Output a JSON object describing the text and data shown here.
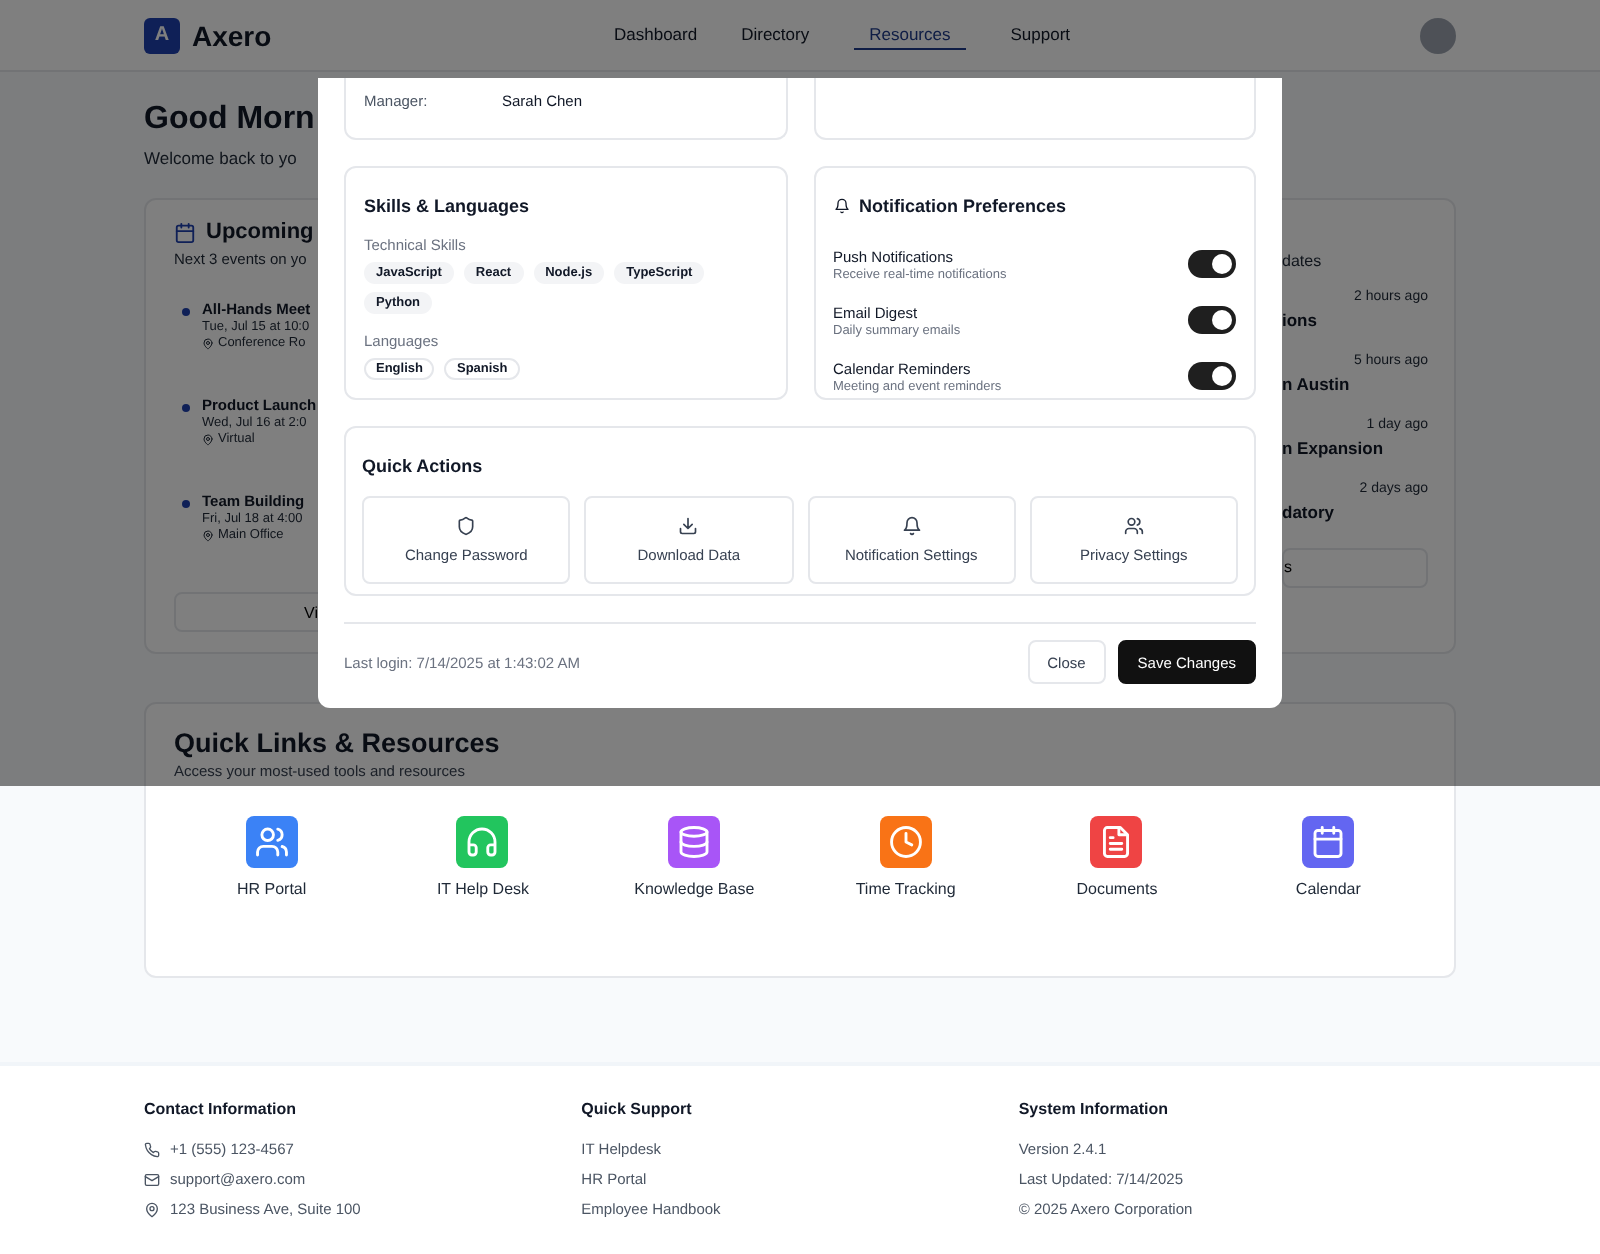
{
  "header": {
    "logo_letter": "A",
    "brand": "Axero",
    "nav": [
      {
        "label": "Dashboard",
        "selected": false
      },
      {
        "label": "Directory",
        "selected": false
      },
      {
        "label": "Resources",
        "selected": true
      },
      {
        "label": "Support",
        "selected": false
      }
    ]
  },
  "greeting": {
    "title": "Good Morn",
    "subtitle": "Welcome back to yo"
  },
  "events_card": {
    "title": "Upcoming",
    "subtitle": "Next 3 events on yo",
    "events": [
      {
        "title": "All-Hands Meet",
        "time": "Tue, Jul 15 at 10:0",
        "location": "Conference Ro"
      },
      {
        "title": "Product Launch",
        "time": "Wed, Jul 16 at 2:0",
        "location": "Virtual"
      },
      {
        "title": "Team Building",
        "time": "Fri, Jul 18 at 4:00",
        "location": "Main Office"
      }
    ],
    "button": "Vi"
  },
  "updates_card": {
    "subtitle": "dates",
    "items": [
      {
        "time": "2 hours ago",
        "title": "ions"
      },
      {
        "time": "5 hours ago",
        "title": "n Austin"
      },
      {
        "time": "1 day ago",
        "title": "n Expansion"
      },
      {
        "time": "2 days ago",
        "title": "datory"
      }
    ],
    "button": "s"
  },
  "quick_links": {
    "title": "Quick Links & Resources",
    "subtitle": "Access your most-used tools and resources",
    "items": [
      {
        "label": "HR Portal",
        "kind": "users",
        "color": "#3b82f6"
      },
      {
        "label": "IT Help Desk",
        "kind": "headphones",
        "color": "#22c55e"
      },
      {
        "label": "Knowledge Base",
        "kind": "database",
        "color": "#a855f7"
      },
      {
        "label": "Time Tracking",
        "kind": "clock",
        "color": "#f97316"
      },
      {
        "label": "Documents",
        "kind": "document",
        "color": "#ef4444"
      },
      {
        "label": "Calendar",
        "kind": "calendar",
        "color": "#6366f1"
      }
    ]
  },
  "footer": {
    "contact": {
      "title": "Contact Information",
      "items": [
        {
          "kind": "phone",
          "text": "+1 (555) 123-4567"
        },
        {
          "kind": "mail",
          "text": "support@axero.com"
        },
        {
          "kind": "pin",
          "text": "123 Business Ave, Suite 100"
        }
      ]
    },
    "support": {
      "title": "Quick Support",
      "items": [
        "IT Helpdesk",
        "HR Portal",
        "Employee Handbook"
      ]
    },
    "system": {
      "title": "System Information",
      "items": [
        "Version 2.4.1",
        "Last Updated: 7/14/2025",
        "© 2025 Axero Corporation"
      ]
    }
  },
  "modal": {
    "profile_rows": [
      {
        "label": "Manager:",
        "value": "Sarah Chen"
      }
    ],
    "skills": {
      "title": "Skills & Languages",
      "technical_label": "Technical Skills",
      "technical": [
        "JavaScript",
        "React",
        "Node.js",
        "TypeScript",
        "Python"
      ],
      "languages_label": "Languages",
      "languages": [
        "English",
        "Spanish"
      ]
    },
    "notifications": {
      "title": "Notification Preferences",
      "items": [
        {
          "name": "Push Notifications",
          "description": "Receive real-time notifications",
          "on": true
        },
        {
          "name": "Email Digest",
          "description": "Daily summary emails",
          "on": true
        },
        {
          "name": "Calendar Reminders",
          "description": "Meeting and event reminders",
          "on": true
        }
      ]
    },
    "quick_actions": {
      "title": "Quick Actions",
      "items": [
        {
          "label": "Change Password",
          "kind": "shield"
        },
        {
          "label": "Download Data",
          "kind": "download"
        },
        {
          "label": "Notification Settings",
          "kind": "bell"
        },
        {
          "label": "Privacy Settings",
          "kind": "users"
        }
      ]
    },
    "last_login": "Last login: 7/14/2025 at 1:43:02 AM",
    "buttons": [
      {
        "label": "Close",
        "kind": "secondary"
      },
      {
        "label": "Save Changes",
        "kind": "primary"
      }
    ]
  }
}
